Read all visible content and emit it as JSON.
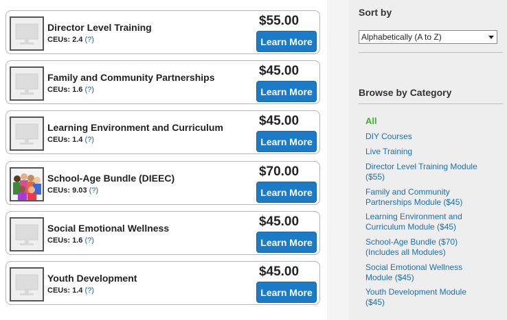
{
  "courses": [
    {
      "title": "Director Level Training",
      "ceu_label": "CEUs:",
      "ceus": "2.4",
      "help": "(?)",
      "price": "$55.00",
      "button": "Learn More",
      "thumb": "monitor-icon"
    },
    {
      "title": "Family and Community Partnerships",
      "ceu_label": "CEUs:",
      "ceus": "1.6",
      "help": "(?)",
      "price": "$45.00",
      "button": "Learn More",
      "thumb": "monitor-icon"
    },
    {
      "title": "Learning Environment and Curriculum",
      "ceu_label": "CEUs:",
      "ceus": "1.4",
      "help": "(?)",
      "price": "$45.00",
      "button": "Learn More",
      "thumb": "monitor-icon"
    },
    {
      "title": "School-Age Bundle (DIEEC)",
      "ceu_label": "CEUs:",
      "ceus": "9.03",
      "help": "(?)",
      "price": "$70.00",
      "button": "Learn More",
      "thumb": "children-photo"
    },
    {
      "title": "Social Emotional Wellness",
      "ceu_label": "CEUs:",
      "ceus": "1.6",
      "help": "(?)",
      "price": "$45.00",
      "button": "Learn More",
      "thumb": "monitor-icon"
    },
    {
      "title": "Youth Development",
      "ceu_label": "CEUs:",
      "ceus": "1.4",
      "help": "(?)",
      "price": "$45.00",
      "button": "Learn More",
      "thumb": "monitor-icon"
    }
  ],
  "sidebar": {
    "sort_heading": "Sort by",
    "sort_value": "Alphabetically (A to Z)",
    "browse_heading": "Browse by Category",
    "categories": [
      {
        "line1": "All",
        "line2": ""
      },
      {
        "line1": "DIY Courses",
        "line2": ""
      },
      {
        "line1": "Live Training",
        "line2": ""
      },
      {
        "line1": "Director Level Training Module",
        "line2": "($55)"
      },
      {
        "line1": "Family and Community",
        "line2": "Partnerships Module ($45)"
      },
      {
        "line1": "Learning Environment and",
        "line2": "Curriculum Module ($45)"
      },
      {
        "line1": "School-Age Bundle ($70)",
        "line2": "(Includes all Modules)"
      },
      {
        "line1": "Social Emotional Wellness",
        "line2": "Module ($45)"
      },
      {
        "line1": "Youth Development Module",
        "line2": "($45)"
      }
    ]
  },
  "colors": {
    "button": "#1c7bc6",
    "link": "#1a6fb4",
    "active_category": "#3fae2a"
  }
}
